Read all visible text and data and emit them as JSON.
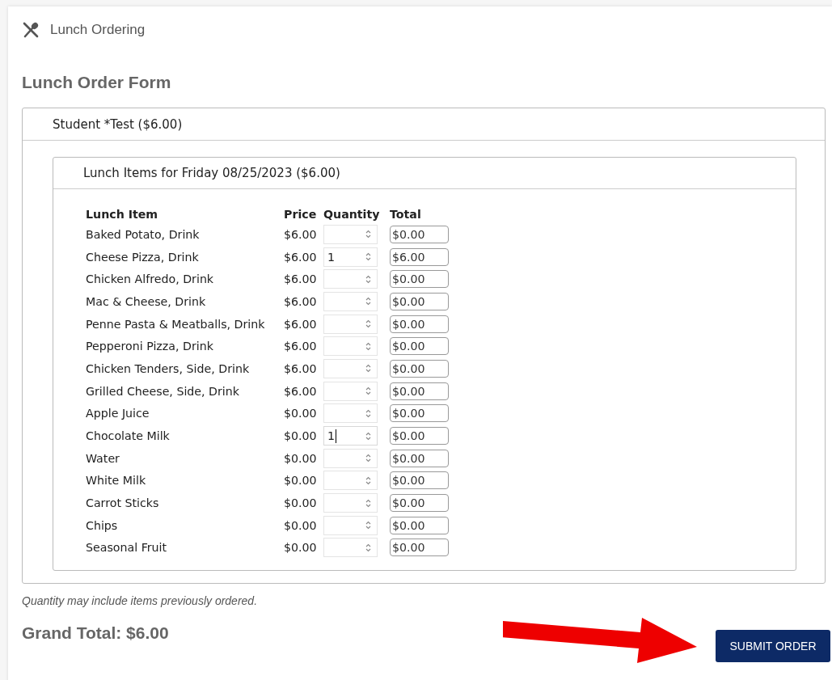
{
  "app_header": {
    "title": "Lunch Ordering"
  },
  "page_title": "Lunch Order Form",
  "student_panel": {
    "title": "Student *Test ($6.00)",
    "day_panel": {
      "title": "Lunch Items for Friday 08/25/2023 ($6.00)",
      "columns": [
        "Lunch Item",
        "Price",
        "Quantity",
        "Total"
      ],
      "rows": [
        {
          "item": "Baked Potato, Drink",
          "price": "$6.00",
          "quantity": "",
          "total": "$0.00",
          "focused": false
        },
        {
          "item": "Cheese Pizza, Drink",
          "price": "$6.00",
          "quantity": "1",
          "total": "$6.00",
          "focused": false
        },
        {
          "item": "Chicken Alfredo, Drink",
          "price": "$6.00",
          "quantity": "",
          "total": "$0.00",
          "focused": false
        },
        {
          "item": "Mac & Cheese, Drink",
          "price": "$6.00",
          "quantity": "",
          "total": "$0.00",
          "focused": false
        },
        {
          "item": "Penne Pasta & Meatballs, Drink",
          "price": "$6.00",
          "quantity": "",
          "total": "$0.00",
          "focused": false
        },
        {
          "item": "Pepperoni Pizza, Drink",
          "price": "$6.00",
          "quantity": "",
          "total": "$0.00",
          "focused": false
        },
        {
          "item": "Chicken Tenders, Side, Drink",
          "price": "$6.00",
          "quantity": "",
          "total": "$0.00",
          "focused": false
        },
        {
          "item": "Grilled Cheese, Side, Drink",
          "price": "$6.00",
          "quantity": "",
          "total": "$0.00",
          "focused": false
        },
        {
          "item": "Apple Juice",
          "price": "$0.00",
          "quantity": "",
          "total": "$0.00",
          "focused": false
        },
        {
          "item": "Chocolate Milk",
          "price": "$0.00",
          "quantity": "1",
          "total": "$0.00",
          "focused": true
        },
        {
          "item": "Water",
          "price": "$0.00",
          "quantity": "",
          "total": "$0.00",
          "focused": false
        },
        {
          "item": "White Milk",
          "price": "$0.00",
          "quantity": "",
          "total": "$0.00",
          "focused": false
        },
        {
          "item": "Carrot Sticks",
          "price": "$0.00",
          "quantity": "",
          "total": "$0.00",
          "focused": false
        },
        {
          "item": "Chips",
          "price": "$0.00",
          "quantity": "",
          "total": "$0.00",
          "focused": false
        },
        {
          "item": "Seasonal Fruit",
          "price": "$0.00",
          "quantity": "",
          "total": "$0.00",
          "focused": false
        }
      ]
    }
  },
  "note": "Quantity may include items previously ordered.",
  "grand_total": "Grand Total: $6.00",
  "submit_button": "SUBMIT ORDER"
}
